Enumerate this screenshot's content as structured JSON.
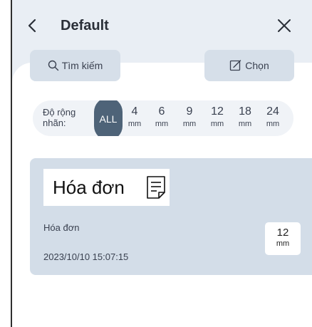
{
  "header": {
    "title": "Default",
    "back_icon": "chevron-left-icon",
    "close_icon": "close-icon"
  },
  "toolbar": {
    "search_label": "Tìm kiếm",
    "search_icon": "search-icon",
    "select_label": "Chọn",
    "select_icon": "edit-icon"
  },
  "filter": {
    "label_line1": "Độ rộng",
    "label_line2": "nhãn:",
    "selected": "ALL",
    "options": [
      {
        "num": "4",
        "unit": "mm"
      },
      {
        "num": "6",
        "unit": "mm"
      },
      {
        "num": "9",
        "unit": "mm"
      },
      {
        "num": "12",
        "unit": "mm"
      },
      {
        "num": "18",
        "unit": "mm"
      },
      {
        "num": "24",
        "unit": "mm"
      }
    ]
  },
  "templates": [
    {
      "preview_text": "Hóa đơn",
      "preview_icon": "document-icon",
      "name": "Hóa đơn",
      "date": "2023/10/10 15:07:15",
      "size_num": "12",
      "size_unit": "mm"
    }
  ],
  "colors": {
    "accent": "#4e6378",
    "panel": "#e9eef4",
    "card": "#d3dde8",
    "button": "#d6dfe9"
  }
}
